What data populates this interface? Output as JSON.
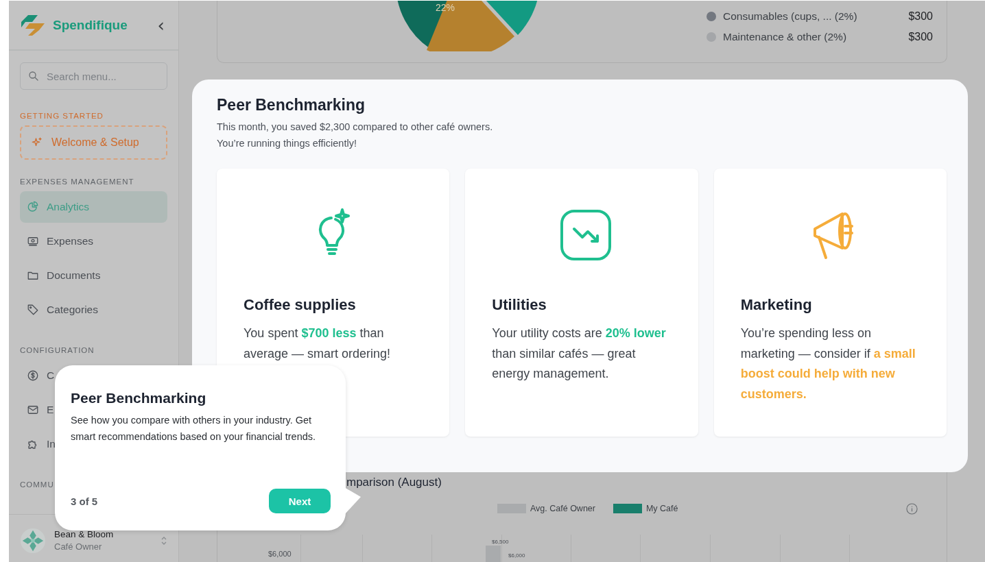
{
  "sidebar": {
    "brand": "Spendifique",
    "collapse": "‹",
    "search": {
      "placeholder": "Search menu..."
    },
    "sections": [
      {
        "title": "GETTING STARTED",
        "kind": "highlight",
        "items": [
          {
            "label": "Welcome & Setup",
            "kind": "setup",
            "selected": false
          }
        ]
      },
      {
        "title": "EXPENSES MANAGEMENT",
        "kind": "plain",
        "items": [
          {
            "label": "Analytics",
            "kind": "link",
            "selected": true
          },
          {
            "label": "Expenses",
            "kind": "link",
            "selected": false
          },
          {
            "label": "Documents",
            "kind": "link",
            "selected": false
          },
          {
            "label": "Categories",
            "kind": "link",
            "selected": false
          }
        ]
      },
      {
        "title": "CONFIGURATION",
        "kind": "plain",
        "items": [
          {
            "label": "C",
            "kind": "link",
            "selected": false
          },
          {
            "label": "E",
            "kind": "link",
            "selected": false
          },
          {
            "label": "In",
            "kind": "link",
            "selected": false
          }
        ]
      },
      {
        "title": "COMMU",
        "kind": "plain"
      }
    ],
    "user": {
      "name": "Bean & Bloom",
      "role": "Café Owner"
    }
  },
  "breakdown": {
    "pie_label": "22%",
    "legend": [
      {
        "label": "Consumables (cups, ... (2%)",
        "amount": "$300",
        "color": "#737880"
      },
      {
        "label": "Maintenance & other (2%)",
        "amount": "$300",
        "color": "#a4a6a9"
      }
    ]
  },
  "benchmark": {
    "title": "Peer Benchmarking",
    "subtitle": [
      "This month, you saved $2,300 compared to other café owners.",
      "You’re running things efficiently!"
    ],
    "cards": [
      {
        "title": "Coffee supplies",
        "text": "You spent **$700 less** than average — smart ordering!",
        "color": "#1fbf8f"
      },
      {
        "title": "Utilities",
        "text": "Your utility costs are **20% lower** than similar cafés — great energy management.",
        "color": "#1fbf8f"
      },
      {
        "title": "Marketing",
        "text": "You’re spending less on marketing — consider if **a small boost could help with new customers.**",
        "color": "#f5ac3a"
      }
    ]
  },
  "comparison": {
    "title": "mparison (August)",
    "legend": [
      {
        "label": "Avg. Café Owner",
        "color": "#a9abad"
      },
      {
        "label": "My Café",
        "color": "#197f6c"
      }
    ],
    "y_tick": "$6,000",
    "bar_labels": [
      "$6,500",
      "$6,000"
    ]
  },
  "tour": {
    "title": "Peer Benchmarking",
    "text": "See how you compare with others in your industry. Get smart recommendations based on your financial trends.",
    "step": "3 of 5",
    "next": "Next"
  }
}
